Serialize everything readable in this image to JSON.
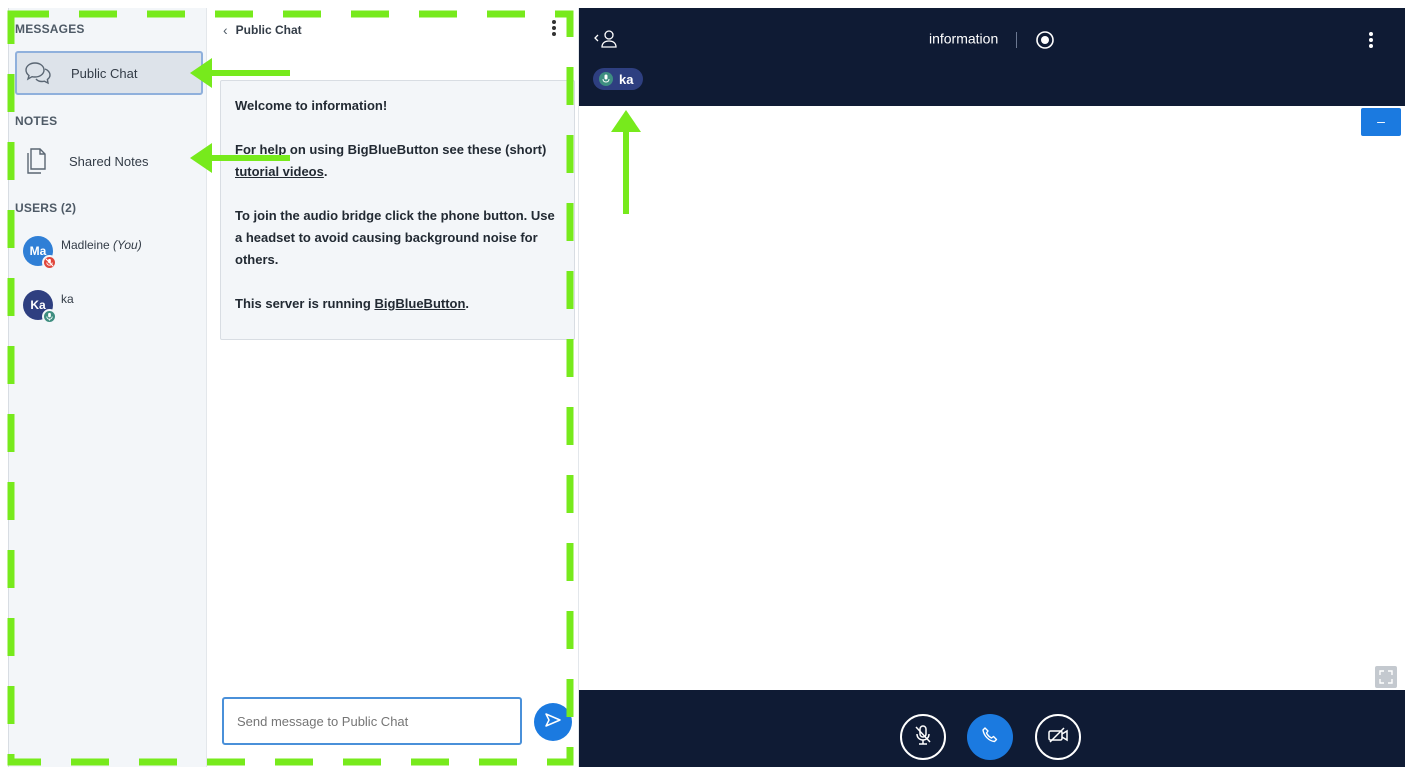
{
  "sidebar": {
    "messages_title": "MESSAGES",
    "public_chat_label": "Public Chat",
    "notes_title": "NOTES",
    "shared_notes_label": "Shared Notes",
    "users_title": "USERS (2)",
    "users": [
      {
        "initials": "Ma",
        "name": "Madleine",
        "suffix": "(You)",
        "avatar_color": "#2f7fd6",
        "status_color": "#e0463c"
      },
      {
        "initials": "Ka",
        "name": "ka",
        "suffix": "",
        "avatar_color": "#2e3f80",
        "status_color": "#3e8e80"
      }
    ]
  },
  "chat": {
    "title": "Public Chat",
    "welcome": {
      "line1_prefix": "Welcome to ",
      "line1_strong": "information",
      "line1_suffix": "!",
      "line2_prefix": "For help on using BigBlueButton see these (short) ",
      "line2_link": "tutorial videos",
      "line2_suffix": ".",
      "line3": "To join the audio bridge click the phone button. Use a headset to avoid causing background noise for others.",
      "line4_prefix": "This server is running ",
      "line4_link": "BigBlueButton",
      "line4_suffix": "."
    },
    "input_placeholder": "Send message to Public Chat"
  },
  "main": {
    "meeting_title": "information",
    "talking_user": "ka",
    "minimize_label": "–"
  },
  "colors": {
    "accent": "#1b7ae0",
    "dark_bar": "#0f1b34",
    "annotation": "#77ea1c"
  }
}
